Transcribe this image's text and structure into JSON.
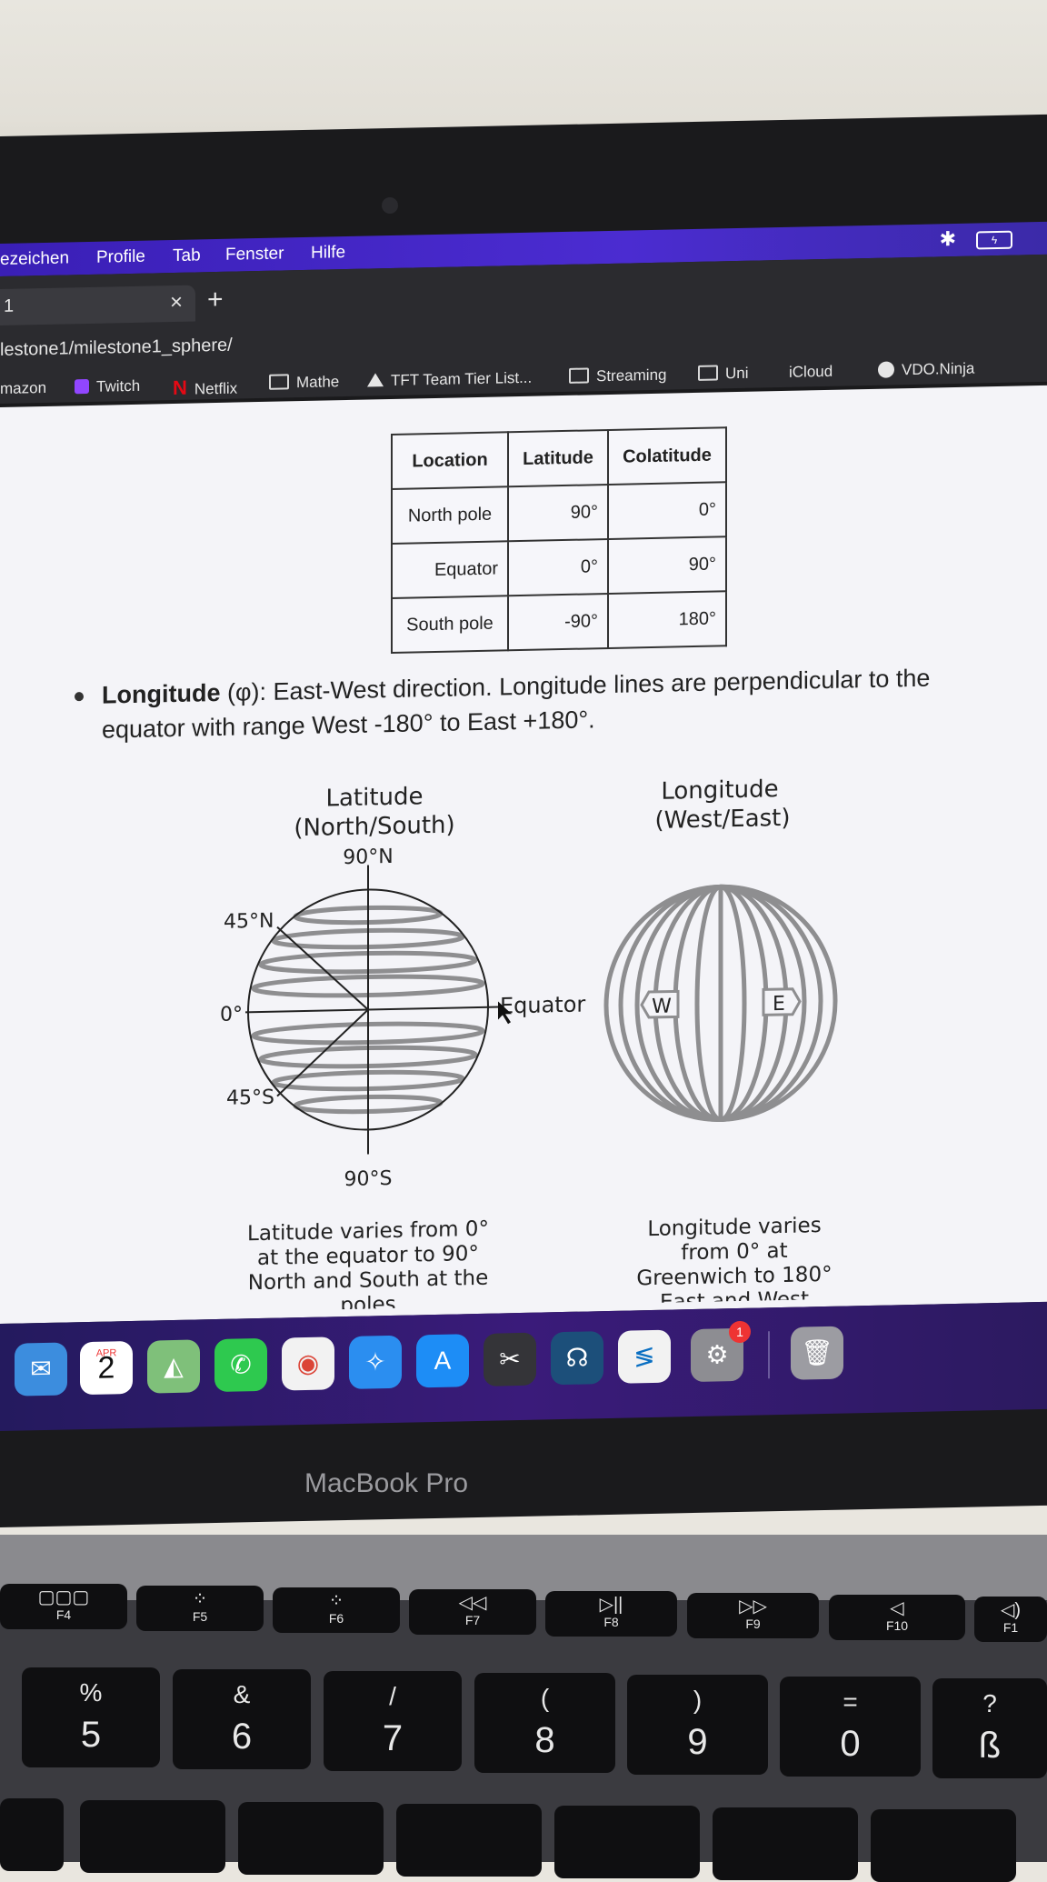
{
  "menu_bar": {
    "items": [
      "ezeichen",
      "Profile",
      "Tab",
      "Fenster",
      "Hilfe"
    ],
    "bluetooth_icon": "bluetooth-icon",
    "battery_icon": "battery-charging-icon"
  },
  "browser": {
    "tab_title": "1",
    "tab_close": "×",
    "new_tab": "+",
    "url": "lestone1/milestone1_sphere/",
    "bookmarks": [
      {
        "label": "mazon",
        "icon": "none"
      },
      {
        "label": "Twitch",
        "icon": "twitch-icon"
      },
      {
        "label": "Netflix",
        "icon": "netflix-icon"
      },
      {
        "label": "Mathe",
        "icon": "folder-icon"
      },
      {
        "label": "TFT Team Tier List...",
        "icon": "tft-icon"
      },
      {
        "label": "Streaming",
        "icon": "folder-icon"
      },
      {
        "label": "Uni",
        "icon": "folder-icon"
      },
      {
        "label": "iCloud",
        "icon": "apple-icon"
      },
      {
        "label": "VDO.Ninja",
        "icon": "vdo-icon"
      }
    ]
  },
  "table": {
    "headers": [
      "Location",
      "Latitude",
      "Colatitude"
    ],
    "rows": [
      [
        "North pole",
        "90°",
        "0°"
      ],
      [
        "Equator",
        "0°",
        "90°"
      ],
      [
        "South pole",
        "-90°",
        "180°"
      ]
    ]
  },
  "bullet": {
    "term": "Longitude",
    "symbol": "(φ)",
    "text": ": East-West direction. Longitude lines are perpendicular to the equator with range West -180° to East +180°."
  },
  "diagram": {
    "latitude": {
      "title1": "Latitude",
      "title2": "(North/South)",
      "north": "90°N",
      "n45": "45°N",
      "zero": "0°",
      "s45": "45°S",
      "south": "90°S",
      "equator": "Equator",
      "caption": [
        "Latitude varies from 0°",
        "at the equator to 90°",
        "North and South at the",
        "poles"
      ]
    },
    "longitude": {
      "title1": "Longitude",
      "title2": "(West/East)",
      "west": "W",
      "east": "E",
      "caption": [
        "Longitude varies",
        "from 0° at",
        "Greenwich to 180°",
        "East and West"
      ]
    }
  },
  "dock": {
    "calendar_month": "APR",
    "calendar_day": "2",
    "settings_badge": "1",
    "apps": [
      "mail-icon",
      "calendar-icon",
      "maps-icon",
      "whatsapp-icon",
      "chrome-icon",
      "safari-icon",
      "app-store-icon",
      "final-cut-icon",
      "headset-app-icon",
      "vscode-icon",
      "system-settings-icon",
      "trash-icon"
    ]
  },
  "laptop": {
    "brand": "MacBook Pro"
  },
  "keyboard": {
    "function_keys": [
      {
        "glyph": "▢▢▢",
        "label": "F4"
      },
      {
        "glyph": "⁘",
        "label": "F5"
      },
      {
        "glyph": "⁘",
        "label": "F6"
      },
      {
        "glyph": "◁◁",
        "label": "F7"
      },
      {
        "glyph": "▷||",
        "label": "F8"
      },
      {
        "glyph": "▷▷",
        "label": "F9"
      },
      {
        "glyph": "◁",
        "label": "F10"
      },
      {
        "glyph": "◁)",
        "label": "F1"
      }
    ],
    "number_keys": [
      {
        "top": "%",
        "bottom": "5"
      },
      {
        "top": "&",
        "bottom": "6"
      },
      {
        "top": "/",
        "bottom": "7"
      },
      {
        "top": "(",
        "bottom": "8"
      },
      {
        "top": ")",
        "bottom": "9"
      },
      {
        "top": "=",
        "bottom": "0"
      },
      {
        "top": "?",
        "bottom": "ß"
      }
    ]
  }
}
